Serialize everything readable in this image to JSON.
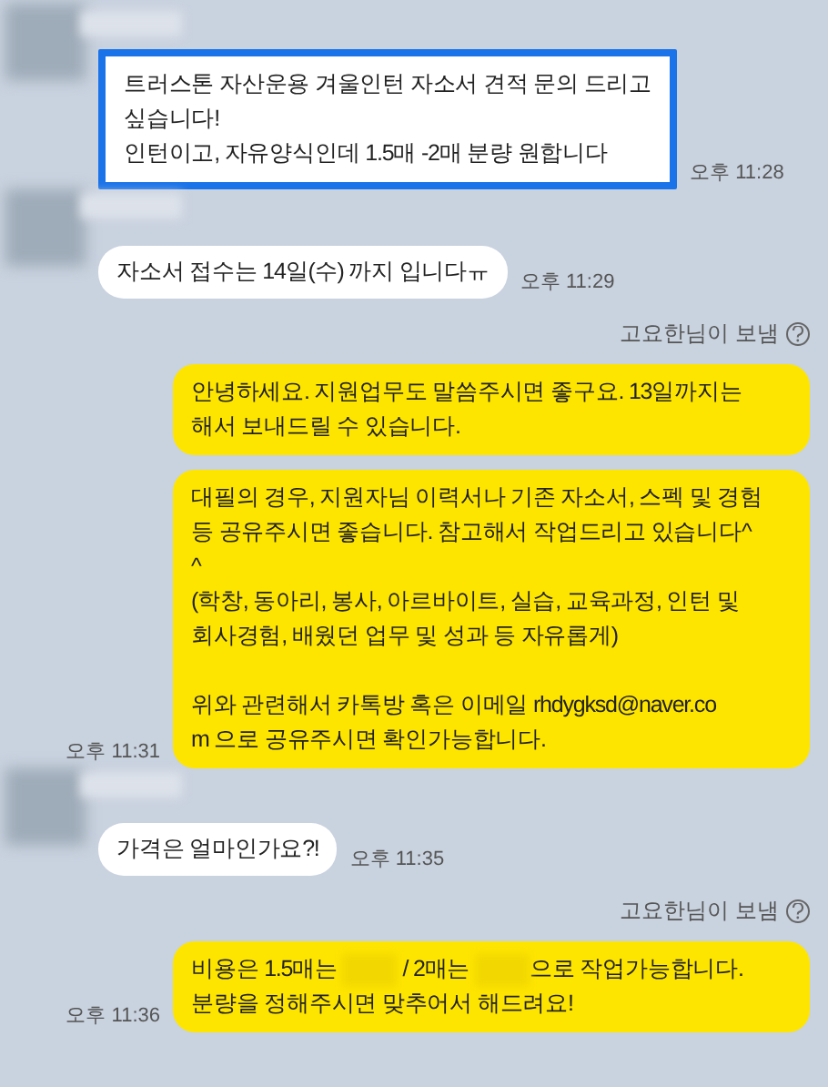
{
  "messages": [
    {
      "kind": "incoming",
      "highlighted": true,
      "parts": [
        {
          "kind": "text",
          "text": "트러스톤 자산운용 겨울인턴 자소서 견적 문의 드리고\n싶습니다!\n인턴이고, 자유양식인데 1.5매 -2매 분량 원합니다"
        }
      ],
      "time": "오후 11:28"
    },
    {
      "kind": "incoming",
      "highlighted": false,
      "parts": [
        {
          "kind": "text",
          "text": "자소서 접수는 14일(수) 까지 입니다ㅠ"
        }
      ],
      "time": "오후 11:29"
    },
    {
      "kind": "outgoing",
      "sender_label": "고요한님이 보냄",
      "parts": [
        {
          "kind": "text",
          "text": "안녕하세요. 지원업무도 말씀주시면 좋구요. 13일까지는\n해서 보내드릴 수 있습니다."
        }
      ]
    },
    {
      "kind": "outgoing",
      "parts": [
        {
          "kind": "text",
          "text": "대필의 경우, 지원자님 이력서나 기존 자소서, 스펙 및 경험\n등 공유주시면 좋습니다. 참고해서 작업드리고 있습니다^\n^\n(학창, 동아리, 봉사, 아르바이트, 실습, 교육과정, 인턴 및\n회사경험, 배웠던 업무 및 성과 등 자유롭게)\n\n위와 관련해서 카톡방 혹은 이메일 rhdygksd@naver.co\nm 으로 공유주시면 확인가능합니다."
        }
      ],
      "time": "오후 11:31"
    },
    {
      "kind": "incoming",
      "highlighted": false,
      "parts": [
        {
          "kind": "text",
          "text": "가격은 얼마인가요?!"
        }
      ],
      "time": "오후 11:35"
    },
    {
      "kind": "outgoing",
      "sender_label": "고요한님이 보냄",
      "parts": [
        {
          "kind": "text",
          "text": "비용은 1.5매는 "
        },
        {
          "kind": "redacted"
        },
        {
          "kind": "text",
          "text": " / 2매는 "
        },
        {
          "kind": "redacted"
        },
        {
          "kind": "text",
          "text": "으로 작업가능합니다.\n분량을 정해주시면 맞추어서 해드려요!"
        }
      ],
      "time": "오후 11:36"
    }
  ]
}
